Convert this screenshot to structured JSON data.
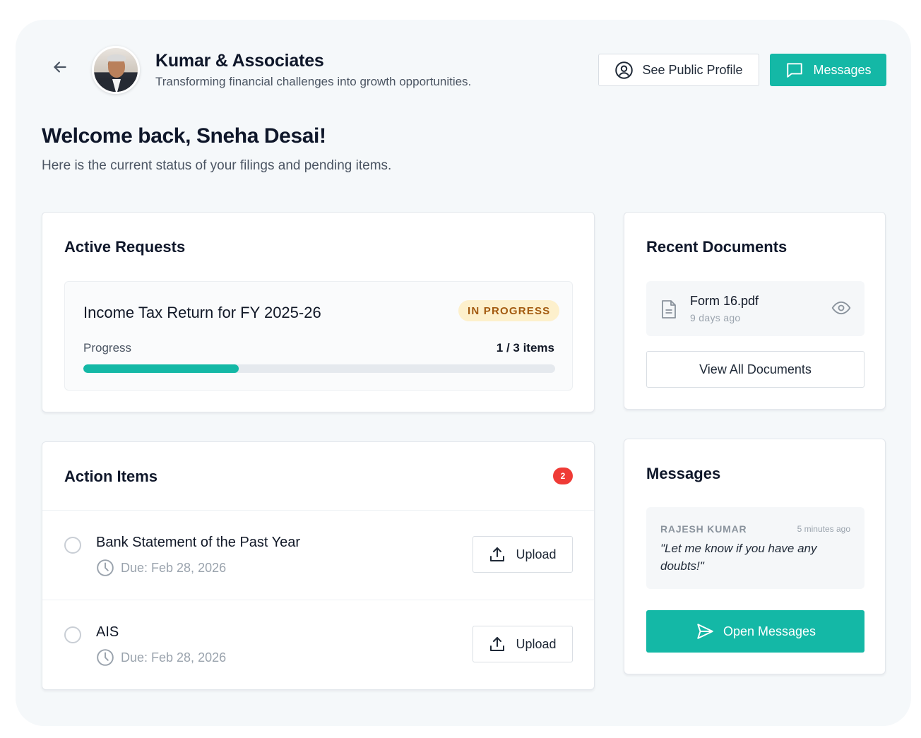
{
  "header": {
    "firm_name": "Kumar & Associates",
    "tagline": "Transforming financial challenges into growth opportunities.",
    "profile_button": "See Public Profile",
    "messages_button": "Messages",
    "back_icon": "arrow-left-icon"
  },
  "welcome": {
    "title": "Welcome back, Sneha Desai!",
    "subtitle": "Here is the current status of your filings and pending items."
  },
  "active_requests": {
    "title": "Active Requests",
    "request": {
      "title": "Income Tax Return for FY 2025-26",
      "status": "IN PROGRESS",
      "progress_label": "Progress",
      "progress_count": "1 / 3 items",
      "progress_fraction": 0.33
    }
  },
  "recent_documents": {
    "title": "Recent Documents",
    "documents": [
      {
        "name": "Form 16.pdf",
        "time": "9 days ago"
      }
    ],
    "view_all": "View All Documents"
  },
  "action_items": {
    "title": "Action Items",
    "count": "2",
    "items": [
      {
        "title": "Bank Statement of the Past Year",
        "due": "Due: Feb 28, 2026",
        "action": "Upload"
      },
      {
        "title": "AIS",
        "due": "Due: Feb 28, 2026",
        "action": "Upload"
      }
    ]
  },
  "messages": {
    "title": "Messages",
    "latest": {
      "sender": "RAJESH KUMAR",
      "time": "5 minutes ago",
      "text": "\"Let me know if you have any doubts!\""
    },
    "open_button": "Open Messages"
  },
  "colors": {
    "accent": "#14b8a6",
    "badge_bg": "#fdf0cc",
    "badge_text": "#a35a10",
    "alert": "#ef3b36"
  }
}
